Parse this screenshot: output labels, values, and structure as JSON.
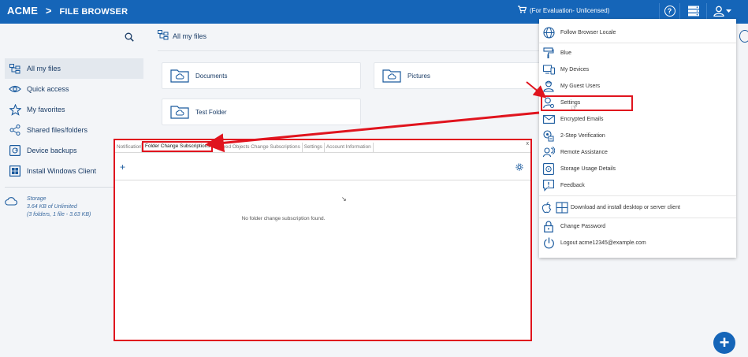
{
  "header": {
    "brand": "ACME",
    "separator": ">",
    "section": "FILE BROWSER",
    "evaluation": "(For Evaluation- Unlicensed)",
    "icons": [
      "cart-icon",
      "help-icon",
      "server-icon",
      "user-icon"
    ]
  },
  "sidebar": {
    "items": [
      {
        "label": "All my files",
        "icon": "folder-tree-icon",
        "active": true
      },
      {
        "label": "Quick access",
        "icon": "eye-icon"
      },
      {
        "label": "My favorites",
        "icon": "star-icon"
      },
      {
        "label": "Shared files/folders",
        "icon": "share-icon"
      },
      {
        "label": "Device backups",
        "icon": "backup-icon"
      },
      {
        "label": "Install Windows Client",
        "icon": "windows-icon"
      }
    ],
    "storage": {
      "title": "Storage",
      "usage": "3.64 KB of Unlimited",
      "detail": "(3 folders, 1 file - 3.63 KB)"
    }
  },
  "main": {
    "breadcrumb": "All my files",
    "folders": [
      "Documents",
      "Pictures",
      "Test Folder"
    ]
  },
  "settings_panel": {
    "tabs": [
      "Notification",
      "Folder Change Subscriptions",
      "Shared Objects Change Subscriptions",
      "Settings",
      "Account Information"
    ],
    "active_tab": "Folder Change Subscriptions",
    "close": "x",
    "add": "+",
    "empty_message": "No folder change subscription found."
  },
  "user_menu": {
    "items": [
      {
        "label": "Follow Browser Locale",
        "icon": "globe-icon"
      },
      {
        "label": "Blue",
        "icon": "paint-roller-icon"
      },
      {
        "label": "My Devices",
        "icon": "devices-icon"
      },
      {
        "label": "My Guest Users",
        "icon": "guest-user-icon"
      },
      {
        "label": "Settings",
        "icon": "user-settings-icon"
      },
      {
        "label": "Encrypted Emails",
        "icon": "envelope-icon"
      },
      {
        "label": "2-Step Verification",
        "icon": "verification-icon"
      },
      {
        "label": "Remote Assistance",
        "icon": "remote-assistance-icon"
      },
      {
        "label": "Storage Usage Details",
        "icon": "storage-icon"
      },
      {
        "label": "Feedback",
        "icon": "feedback-icon"
      },
      {
        "label": "Download and install desktop or server client",
        "icon": "apple-windows-icon"
      },
      {
        "label": "Change Password",
        "icon": "lock-icon"
      },
      {
        "label": "Logout acme12345@example.com",
        "icon": "power-icon"
      }
    ]
  },
  "colors": {
    "header": "#1565b8",
    "annotation": "#e0141e",
    "icon": "#1a5a9e"
  }
}
